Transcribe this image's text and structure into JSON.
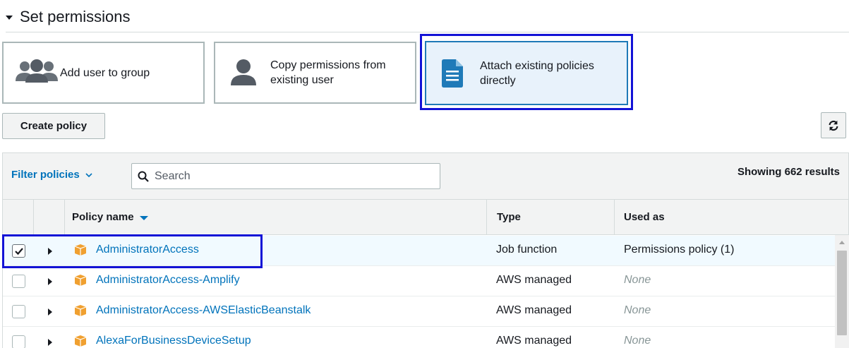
{
  "section": {
    "title": "Set permissions"
  },
  "options": {
    "group": {
      "label": "Add user to group"
    },
    "copy": {
      "label_line1": "Copy permissions from",
      "label_line2": "existing user"
    },
    "attach": {
      "label_line1": "Attach existing policies",
      "label_line2": "directly",
      "selected": true
    }
  },
  "toolbar": {
    "create_policy_label": "Create policy",
    "refresh_icon": "refresh-icon"
  },
  "filter": {
    "filter_label": "Filter policies",
    "search_placeholder": "Search",
    "search_value": "",
    "results_text": "Showing 662 results"
  },
  "table": {
    "columns": {
      "name": "Policy name",
      "type": "Type",
      "used_as": "Used as"
    },
    "rows": [
      {
        "name": "AdministratorAccess",
        "type": "Job function",
        "used_as": "Permissions policy (1)",
        "checked": true
      },
      {
        "name": "AdministratorAccess-Amplify",
        "type": "AWS managed",
        "used_as": "None",
        "checked": false
      },
      {
        "name": "AdministratorAccess-AWSElasticBeanstalk",
        "type": "AWS managed",
        "used_as": "None",
        "checked": false
      },
      {
        "name": "AlexaForBusinessDeviceSetup",
        "type": "AWS managed",
        "used_as": "None",
        "checked": false
      }
    ]
  },
  "colors": {
    "link": "#0073bb",
    "selected_bg": "#e8f2fb",
    "policy_icon": "#f0a030",
    "highlight": "#1313d6"
  }
}
